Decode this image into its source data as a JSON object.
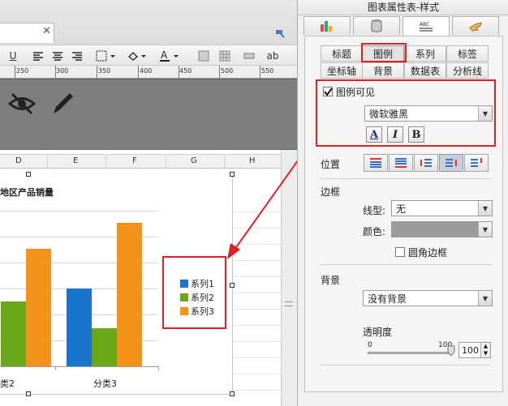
{
  "toolbar": {
    "underline_label": "U",
    "text_ab_label": "ab"
  },
  "ruler": {
    "marks": [
      "250",
      "300",
      "350",
      "400",
      "450",
      "500",
      "550"
    ]
  },
  "sheet": {
    "columns": [
      "D",
      "E",
      "F",
      "G",
      "H"
    ]
  },
  "chart_data": {
    "type": "bar",
    "title": "地区产品销量",
    "categories": [
      "类2",
      "分类3"
    ],
    "series": [
      {
        "name": "系列1",
        "color": "#1874cd",
        "values": [
          null,
          96
        ]
      },
      {
        "name": "系列2",
        "color": "#6aa81a",
        "values": [
          80,
          47
        ]
      },
      {
        "name": "系列3",
        "color": "#f5921c",
        "values": [
          145,
          177
        ]
      }
    ],
    "legend": "right"
  },
  "panel": {
    "title": "图表属性表-样式",
    "main_tabs": [
      {
        "icon": "chart-style-icon"
      },
      {
        "icon": "database-icon"
      },
      {
        "icon": "abc-text-icon"
      },
      {
        "icon": "hand-pointer-icon"
      }
    ],
    "subtabs_row1": [
      "标题",
      "图例",
      "系列",
      "标签"
    ],
    "subtabs_row2": [
      "坐标轴",
      "背景",
      "数据表",
      "分析线"
    ],
    "legend_visible_label": "图例可见",
    "legend_visible_checked": true,
    "font_value": "微软雅黑",
    "font_buttons": {
      "color": "A",
      "italic": "I",
      "bold": "B"
    },
    "position_label": "位置",
    "border_label": "边框",
    "line_type_label": "线型:",
    "line_type_value": "无",
    "color_label": "颜色:",
    "rounded_border_label": "圆角边框",
    "background_label": "背景",
    "background_value": "没有背景",
    "transparency_label": "透明度",
    "slider_min": "0",
    "slider_max": "100",
    "transparency_value": "100"
  },
  "colors": {
    "highlight": "#e02020",
    "accent_blue": "#1874cd"
  }
}
